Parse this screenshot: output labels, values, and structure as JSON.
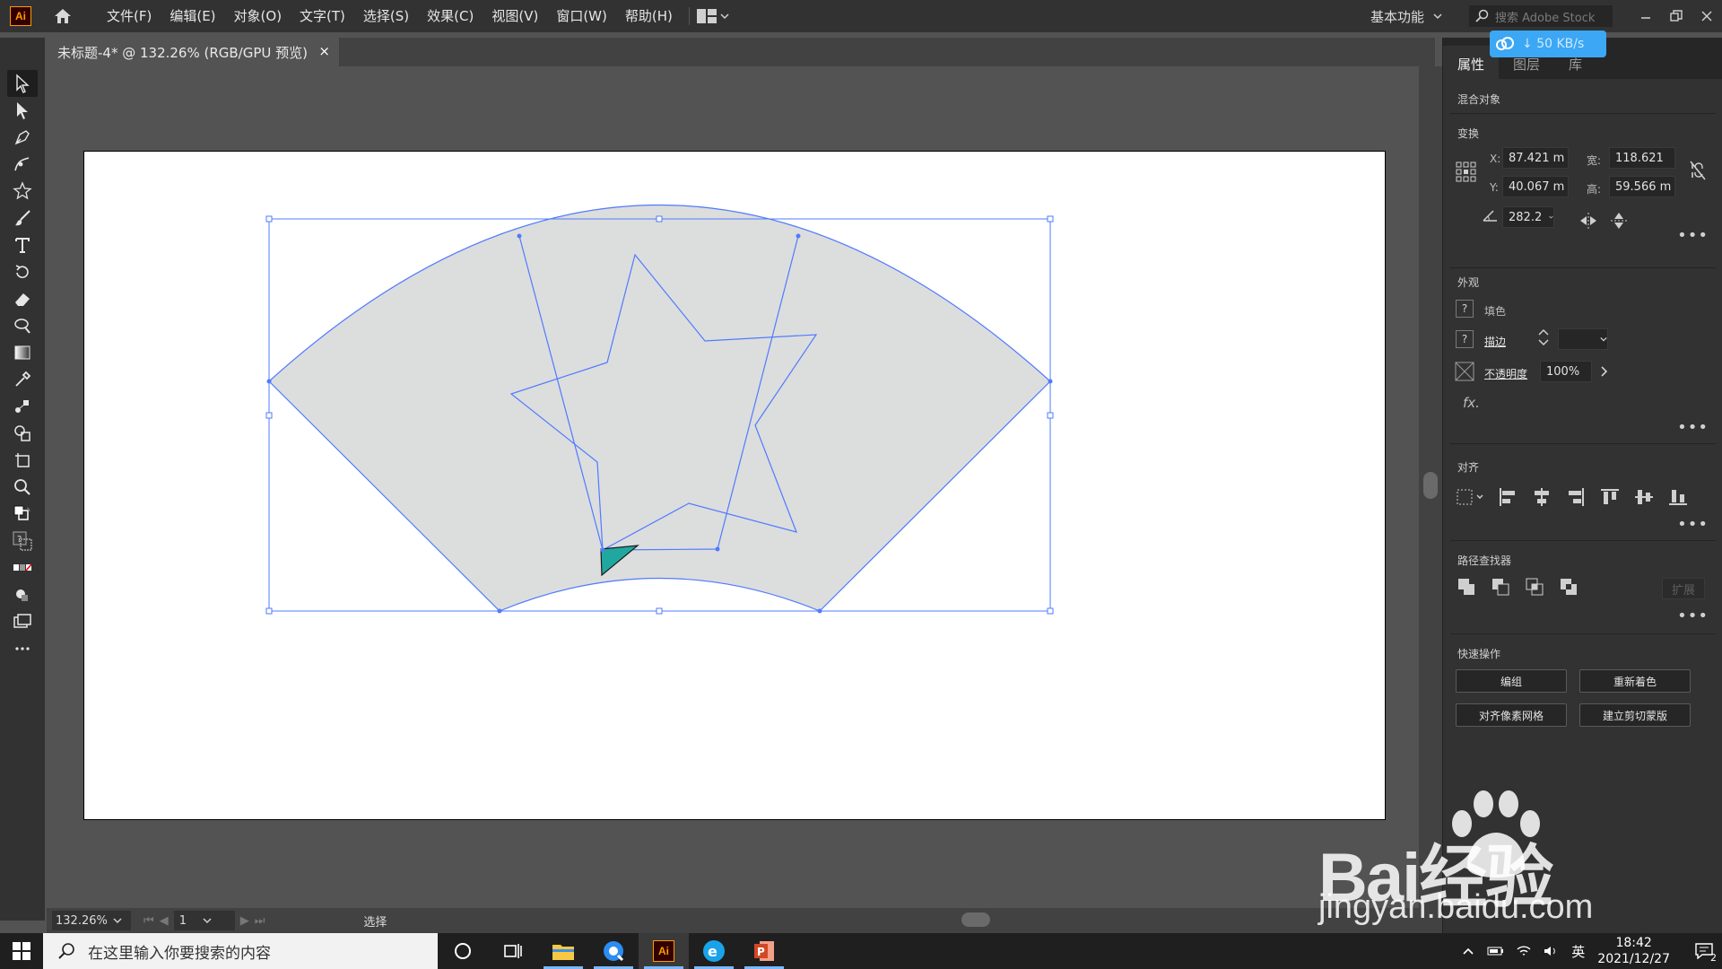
{
  "app": {
    "logo": "Ai"
  },
  "menu": [
    "文件(F)",
    "编辑(E)",
    "对象(O)",
    "文字(T)",
    "选择(S)",
    "效果(C)",
    "视图(V)",
    "窗口(W)",
    "帮助(H)"
  ],
  "workspace": {
    "label": "基本功能"
  },
  "search": {
    "placeholder": "搜索 Adobe Stock"
  },
  "document": {
    "tab_title": "未标题-4* @ 132.26% (RGB/GPU 预览)",
    "close": "×"
  },
  "cloud": {
    "speed": "50 KB/s"
  },
  "panel": {
    "tabs": [
      "属性",
      "图层",
      "库"
    ],
    "object_type": "混合对象",
    "transform": {
      "title": "变换",
      "x_label": "X:",
      "x": "87.421 m",
      "y_label": "Y:",
      "y": "40.067 m",
      "w_label": "宽:",
      "w": "118.621",
      "h_label": "高:",
      "h": "59.566 m",
      "angle": "282.2"
    },
    "appearance": {
      "title": "外观",
      "fill": "填色",
      "stroke": "描边",
      "opacity_label": "不透明度",
      "opacity": "100%",
      "fx": "fx."
    },
    "align": {
      "title": "对齐"
    },
    "pathfinder": {
      "title": "路径查找器",
      "expand": "扩展"
    },
    "quick": {
      "title": "快速操作",
      "group": "编组",
      "recolor": "重新着色",
      "pixel_grid": "对齐像素网格",
      "clip_mask": "建立剪切蒙版"
    }
  },
  "status": {
    "zoom": "132.26%",
    "page": "1",
    "tool": "选择"
  },
  "taskbar": {
    "search_placeholder": "在这里输入你要搜索的内容",
    "ime": "英",
    "time": "18:42",
    "date": "2021/12/27",
    "notify_count": "2"
  },
  "watermark": {
    "line1": "Bai经验",
    "line2": "jingyan.baidu.com"
  },
  "colors": {
    "selection": "#4f7bff",
    "fan_fill": "#dcdddd",
    "teal": "#20a8a0"
  }
}
